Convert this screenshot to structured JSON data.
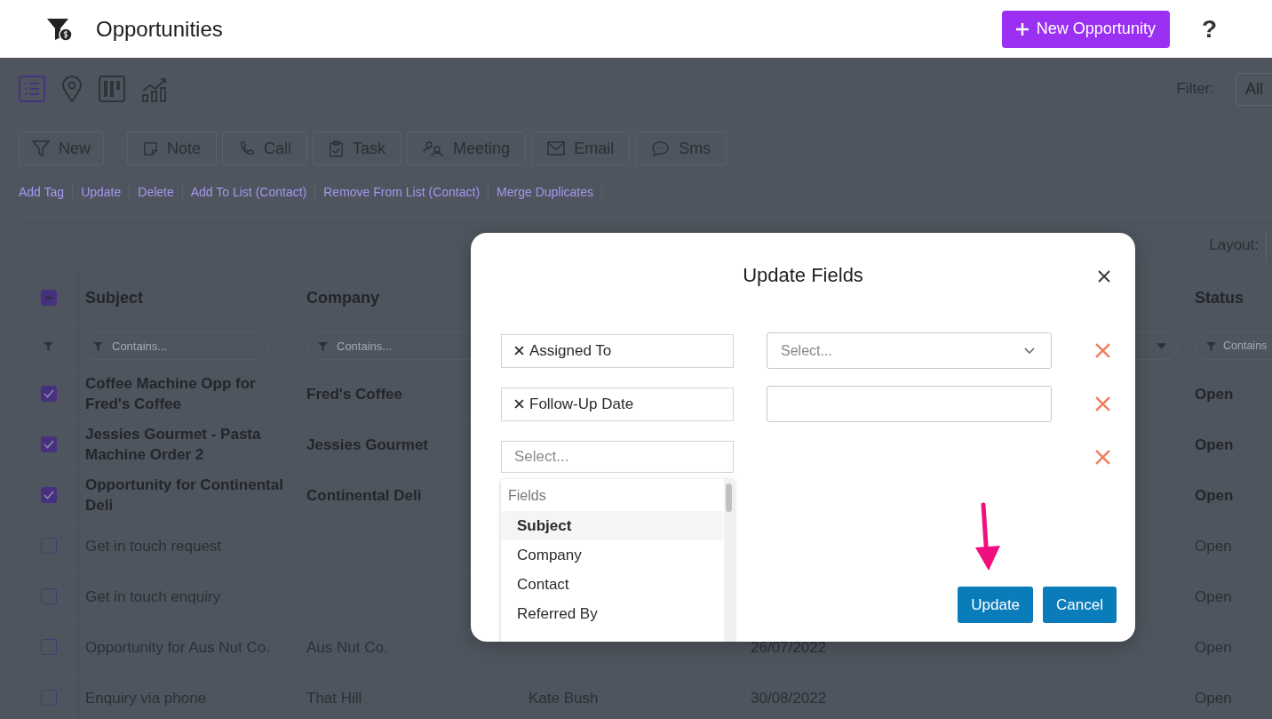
{
  "header": {
    "title": "Opportunities",
    "new_button": "New Opportunity",
    "help": "?"
  },
  "view_tabs": [
    {
      "kind": "list",
      "selected": true
    },
    {
      "kind": "map",
      "selected": false
    },
    {
      "kind": "board",
      "selected": false
    },
    {
      "kind": "chart",
      "selected": false
    }
  ],
  "filter": {
    "label": "Filter:",
    "value": "All"
  },
  "actions": [
    {
      "kind": "filter",
      "label": "New"
    },
    {
      "kind": "note",
      "label": "Note"
    },
    {
      "kind": "call",
      "label": "Call"
    },
    {
      "kind": "task",
      "label": "Task"
    },
    {
      "kind": "meeting",
      "label": "Meeting"
    },
    {
      "kind": "email",
      "label": "Email"
    },
    {
      "kind": "sms",
      "label": "Sms"
    }
  ],
  "bulk_links": [
    "Add Tag",
    "Update",
    "Delete",
    "Add To List (Contact)",
    "Remove From List (Contact)",
    "Merge Duplicates"
  ],
  "layout_label": "Layout:",
  "table": {
    "select_all_partial": true,
    "columns": {
      "subject": {
        "label": "Subject",
        "filter_placeholder": "Contains..."
      },
      "company": {
        "label": "Company",
        "filter_placeholder": "Contains..."
      },
      "column_4": {
        "filter_dropdown": true
      },
      "status": {
        "label": "Status",
        "filter_placeholder": "Contains"
      }
    },
    "rows": [
      {
        "selected": true,
        "subject": "Coffee Machine Opp for Fred's Coffee",
        "company": "Fred's Coffee",
        "status": "Open"
      },
      {
        "selected": true,
        "subject": "Jessies Gourmet - Pasta Machine Order 2",
        "company": "Jessies Gourmet",
        "status": "Open"
      },
      {
        "selected": true,
        "subject": "Opportunity for Continental Deli",
        "company": "Continental Deli",
        "status": "Open"
      },
      {
        "selected": false,
        "subject": "Get in touch request",
        "status": "Open"
      },
      {
        "selected": false,
        "subject": "Get in touch enquiry",
        "status": "Open"
      },
      {
        "selected": false,
        "subject": "Opportunity for Aus Nut Co.",
        "company": "Aus Nut Co.",
        "column_4": "26/07/2022",
        "status": "Open"
      },
      {
        "selected": false,
        "subject": "Enquiry via phone",
        "company": "That Hill",
        "column_3": "Kate Bush",
        "column_4": "30/08/2022",
        "status": "Open"
      }
    ]
  },
  "modal": {
    "title": "Update Fields",
    "rows": [
      {
        "kind": "select",
        "field": "Assigned To",
        "value_placeholder": "Select..."
      },
      {
        "kind": "input",
        "field": "Follow-Up Date"
      },
      {
        "kind": "picker",
        "field_placeholder": "Select..."
      }
    ],
    "dropdown": {
      "group": "Fields",
      "options": [
        {
          "label": "Subject",
          "selected": true
        },
        {
          "label": "Company",
          "selected": false
        },
        {
          "label": "Contact",
          "selected": false
        },
        {
          "label": "Referred By",
          "selected": false
        }
      ]
    },
    "buttons": [
      "Update",
      "Cancel"
    ]
  }
}
